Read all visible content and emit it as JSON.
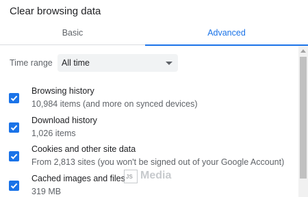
{
  "dialog": {
    "title": "Clear browsing data"
  },
  "tabs": [
    {
      "label": "Basic",
      "active": false
    },
    {
      "label": "Advanced",
      "active": true
    }
  ],
  "time_range": {
    "label": "Time range",
    "value": "All time"
  },
  "options": [
    {
      "title": "Browsing history",
      "description": "10,984 items (and more on synced devices)",
      "checked": true
    },
    {
      "title": "Download history",
      "description": "1,026 items",
      "checked": true
    },
    {
      "title": "Cookies and other site data",
      "description": "From 2,813 sites (you won't be signed out of your Google Account)",
      "checked": true
    },
    {
      "title": "Cached images and files",
      "description": "319 MB",
      "checked": true
    }
  ],
  "watermark": {
    "text": "Media",
    "logo_text": "JS"
  },
  "colors": {
    "accent": "#1a73e8",
    "text": "#202124",
    "secondary_text": "#5f6368",
    "select_bg": "#f1f3f4"
  },
  "icons": {
    "checkbox": "check-icon",
    "dropdown": "chevron-down-icon",
    "scroll_up": "scroll-up-arrow-icon"
  }
}
